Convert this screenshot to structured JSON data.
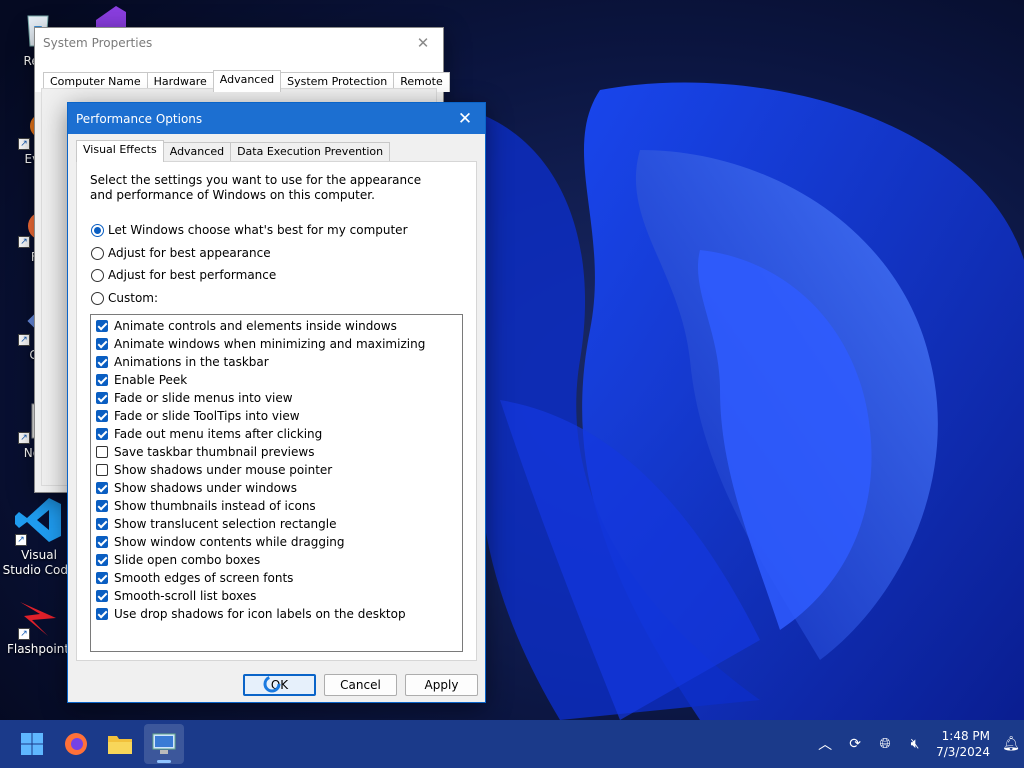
{
  "desktop": {
    "icons": [
      {
        "label": "Recy",
        "icon": "recycle-bin-icon"
      },
      {
        "label": "Ever",
        "icon": "everything-icon"
      },
      {
        "label": "Fir",
        "icon": "firefox-icon"
      },
      {
        "label": "Git",
        "icon": "git-icon"
      },
      {
        "label": "Note",
        "icon": "notepad-icon"
      },
      {
        "label": "Visual Studio Code",
        "icon": "vscode-icon"
      },
      {
        "label": "Flashpoint",
        "icon": "flashpoint-icon"
      }
    ]
  },
  "system_properties": {
    "title": "System Properties",
    "tabs": [
      {
        "label": "Computer Name"
      },
      {
        "label": "Hardware"
      },
      {
        "label": "Advanced"
      },
      {
        "label": "System Protection"
      },
      {
        "label": "Remote"
      }
    ],
    "active_tab": "Advanced"
  },
  "performance_options": {
    "title": "Performance Options",
    "tabs": [
      {
        "label": "Visual Effects"
      },
      {
        "label": "Advanced"
      },
      {
        "label": "Data Execution Prevention"
      }
    ],
    "active_tab": "Visual Effects",
    "description": "Select the settings you want to use for the appearance and performance of Windows on this computer.",
    "radio_options": [
      {
        "label": "Let Windows choose what's best for my computer",
        "selected": true
      },
      {
        "label": "Adjust for best appearance",
        "selected": false
      },
      {
        "label": "Adjust for best performance",
        "selected": false
      },
      {
        "label": "Custom:",
        "selected": false
      }
    ],
    "effects": [
      {
        "label": "Animate controls and elements inside windows",
        "checked": true
      },
      {
        "label": "Animate windows when minimizing and maximizing",
        "checked": true
      },
      {
        "label": "Animations in the taskbar",
        "checked": true
      },
      {
        "label": "Enable Peek",
        "checked": true
      },
      {
        "label": "Fade or slide menus into view",
        "checked": true
      },
      {
        "label": "Fade or slide ToolTips into view",
        "checked": true
      },
      {
        "label": "Fade out menu items after clicking",
        "checked": true
      },
      {
        "label": "Save taskbar thumbnail previews",
        "checked": false
      },
      {
        "label": "Show shadows under mouse pointer",
        "checked": false
      },
      {
        "label": "Show shadows under windows",
        "checked": true
      },
      {
        "label": "Show thumbnails instead of icons",
        "checked": true
      },
      {
        "label": "Show translucent selection rectangle",
        "checked": true
      },
      {
        "label": "Show window contents while dragging",
        "checked": true
      },
      {
        "label": "Slide open combo boxes",
        "checked": true
      },
      {
        "label": "Smooth edges of screen fonts",
        "checked": true
      },
      {
        "label": "Smooth-scroll list boxes",
        "checked": true
      },
      {
        "label": "Use drop shadows for icon labels on the desktop",
        "checked": true
      }
    ],
    "buttons": {
      "ok": "OK",
      "cancel": "Cancel",
      "apply": "Apply"
    }
  },
  "taskbar": {
    "apps": [
      {
        "name": "start-button"
      },
      {
        "name": "firefox-taskbar-button"
      },
      {
        "name": "file-explorer-taskbar-button"
      },
      {
        "name": "system-properties-taskbar-button",
        "active": true
      }
    ],
    "time": "1:48 PM",
    "date": "7/3/2024"
  },
  "colors": {
    "accent": "#0a64c8",
    "taskbar": "#1b3a8a",
    "titlebar": "#1c6fd1"
  }
}
